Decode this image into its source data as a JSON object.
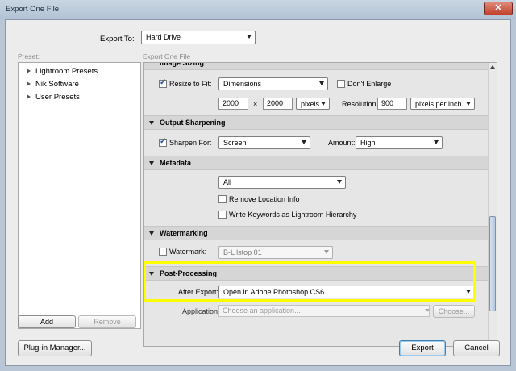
{
  "window": {
    "title": "Export One File"
  },
  "export_to": {
    "label": "Export To:",
    "value": "Hard Drive"
  },
  "preset": {
    "caption": "Preset:",
    "items": [
      "Lightroom Presets",
      "Nik Software",
      "User Presets"
    ],
    "add_label": "Add",
    "remove_label": "Remove"
  },
  "panel": {
    "caption": "Export One File"
  },
  "image_sizing": {
    "title": "Image Sizing",
    "resize_label": "Resize to Fit:",
    "resize_mode": "Dimensions",
    "dont_enlarge_label": "Don't Enlarge",
    "width": "2000",
    "times": "×",
    "height": "2000",
    "unit": "pixels",
    "resolution_label": "Resolution:",
    "resolution": "900",
    "resolution_unit": "pixels per inch"
  },
  "output_sharpening": {
    "title": "Output Sharpening",
    "sharpen_label": "Sharpen For:",
    "sharpen_for": "Screen",
    "amount_label": "Amount:",
    "amount": "High"
  },
  "metadata": {
    "title": "Metadata",
    "include": "All",
    "remove_location_label": "Remove Location Info",
    "write_keywords_label": "Write Keywords as Lightroom Hierarchy"
  },
  "watermarking": {
    "title": "Watermarking",
    "watermark_label": "Watermark:",
    "watermark_value": "B-L lstop 01"
  },
  "post_processing": {
    "title": "Post-Processing",
    "after_export_label": "After Export:",
    "after_export": "Open in Adobe Photoshop CS6",
    "application_label": "Application:",
    "application_placeholder": "Choose an application...",
    "choose_label": "Choose..."
  },
  "footer": {
    "plugin_manager_label": "Plug-in Manager...",
    "export_label": "Export",
    "cancel_label": "Cancel"
  },
  "colors": {
    "highlight": "#ffff00",
    "accent": "#1f4e96"
  }
}
